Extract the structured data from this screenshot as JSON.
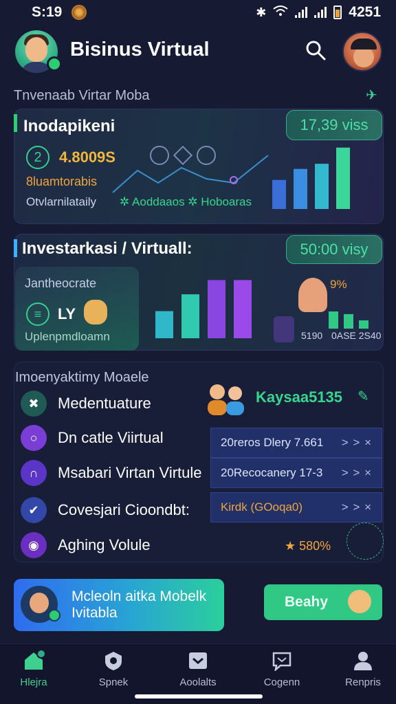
{
  "status_bar": {
    "time": "S:19",
    "battery": "4251"
  },
  "header": {
    "title": "Bisinus Virtual"
  },
  "section1": {
    "heading": "Tnvenaab Virtar Moba"
  },
  "card1": {
    "title": "Inodapikeni",
    "pill": "17,39 viss",
    "badge": "2",
    "amount": "4.8009S",
    "subtitle": "8luamtorabis",
    "footer_left": "Otvlarnilataily",
    "footer_right": "✲ Aoddaaos ✲ Hoboaras",
    "bars": [
      0.45,
      0.62,
      0.7,
      0.95
    ]
  },
  "card2": {
    "title": "Investarkasi / Virtuall:",
    "pill": "50:00 visy",
    "inner_label": "Jantheocrate",
    "code": "LY",
    "footer": "Uplenpmdloamn",
    "percent": "9%",
    "value_a": "5190",
    "value_b": "0ASE 2S40",
    "bars_center": [
      0.42,
      0.68,
      0.9,
      0.9
    ],
    "bars_right": [
      0.52,
      0.44,
      0.25
    ]
  },
  "panel3": {
    "heading": "Imoenyaktimy Moaele",
    "kpi": "Kaysaa5135",
    "menu": [
      {
        "label": "Medentuature",
        "icon": "link-icon",
        "color": "#1f5a55"
      },
      {
        "label": "Dn catle Viirtual",
        "icon": "circle-icon",
        "color": "#7a3ed6"
      },
      {
        "label": "Msabari Virtan Virtule",
        "icon": "arch-icon",
        "color": "#5a35c8"
      },
      {
        "label": "Covesjari Cioondbt:",
        "icon": "shield-check-icon",
        "color": "#3347a8"
      },
      {
        "label": "Aghing Volule",
        "icon": "ring-icon",
        "color": "#6a2fc0"
      }
    ],
    "rows": [
      {
        "text": "20reros Dlery 7.661",
        "chev": "> > ×"
      },
      {
        "text": "20Recocanery 17-3",
        "chev": "> > ×"
      },
      {
        "text": "Kirdk (GOoqa0)",
        "chev": "> > ×"
      }
    ],
    "rating": "★ 580%"
  },
  "promo": {
    "text": "Mcleoln aitka Mobelk Ivitabla",
    "button": "Beahy"
  },
  "nav": [
    {
      "label": "Hlejra",
      "icon": "home-icon"
    },
    {
      "label": "Spnek",
      "icon": "shield-icon"
    },
    {
      "label": "Aoolalts",
      "icon": "tray-icon"
    },
    {
      "label": "Cogenn",
      "icon": "chat-icon"
    },
    {
      "label": "Renpris",
      "icon": "person-icon"
    }
  ],
  "colors": {
    "accent": "#37d68f",
    "warn": "#f0a53c",
    "bg": "#161a33"
  }
}
